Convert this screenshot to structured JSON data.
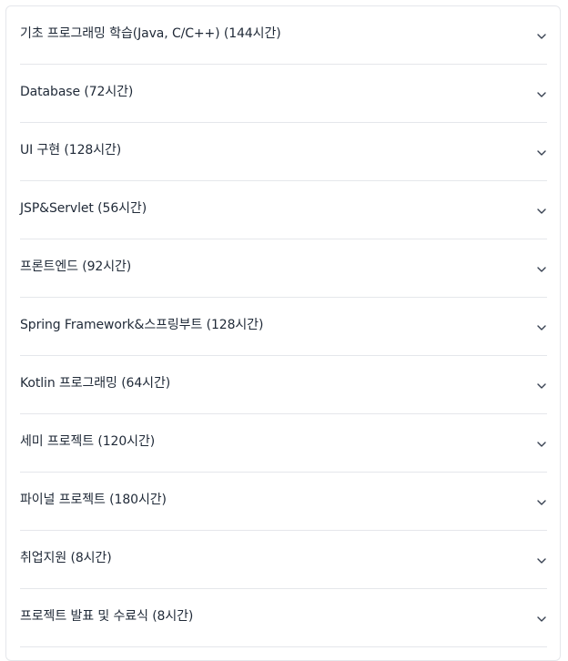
{
  "curriculum": {
    "items": [
      {
        "label": "기초 프로그래밍 학습(Java, C/C++) (144시간)",
        "icon": "chevron-down-icon"
      },
      {
        "label": "Database (72시간)",
        "icon": "chevron-down-icon"
      },
      {
        "label": "UI 구현 (128시간)",
        "icon": "chevron-down-icon"
      },
      {
        "label": "JSP&Servlet (56시간)",
        "icon": "chevron-down-icon"
      },
      {
        "label": "프론트엔드 (92시간)",
        "icon": "chevron-down-icon"
      },
      {
        "label": "Spring Framework&스프링부트 (128시간)",
        "icon": "chevron-down-icon"
      },
      {
        "label": "Kotlin 프로그래밍 (64시간)",
        "icon": "chevron-down-icon"
      },
      {
        "label": "세미 프로젝트 (120시간)",
        "icon": "chevron-down-icon"
      },
      {
        "label": "파이널 프로젝트 (180시간)",
        "icon": "chevron-down-icon"
      },
      {
        "label": "취업지원 (8시간)",
        "icon": "chevron-down-icon"
      },
      {
        "label": "프로젝트 발표 및 수료식 (8시간)",
        "icon": "chevron-down-icon"
      }
    ]
  },
  "colors": {
    "text": "#1f2937",
    "border": "#e5e7eb",
    "chevron": "#374151"
  }
}
